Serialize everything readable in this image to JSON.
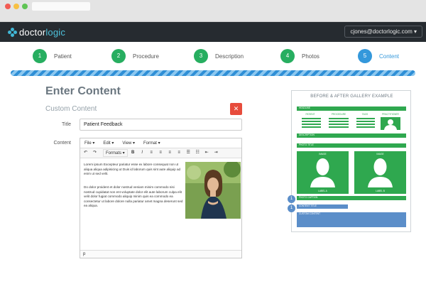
{
  "app": {
    "logo_prefix": "doctor",
    "logo_suffix": "logic",
    "user_menu": "cjones@doctorlogic.com ▾"
  },
  "steps": [
    {
      "number": "1",
      "label": "Patient",
      "active": false
    },
    {
      "number": "2",
      "label": "Procedure",
      "active": false
    },
    {
      "number": "3",
      "label": "Description",
      "active": false
    },
    {
      "number": "4",
      "label": "Photos",
      "active": false
    },
    {
      "number": "5",
      "label": "Content",
      "active": true
    }
  ],
  "page": {
    "title": "Enter Content",
    "section": "Custom Content",
    "close_label": "✕"
  },
  "form": {
    "title_label": "Title",
    "title_value": "Patient Feedback",
    "content_label": "Content"
  },
  "editor": {
    "menu": [
      "File ▾",
      "Edit ▾",
      "View ▾",
      "Format ▾"
    ],
    "formats_label": "Formats ▾",
    "paragraph1": "Lorem ipsum Excepteur pariatur esse ex labore consequat non ut aliqua aliqua adipisicing ut Duis id laborum quis sint aute aliquip ad enim ut sed velit.",
    "paragraph2": "Do dolor proident et dolor nostrud veniam minim commodo nisi nostrud cupidatat non ent voluptate dolor elit aute laborum culpa elit velit dolor fugiat commodo aliquip minim quis ea commodo ea consectetur ut labore dolore nulla pariatur amet magna deserunt sed ea aliqua.",
    "status": "p"
  },
  "gallery": {
    "title": "BEFORE & AFTER GALLERY EXAMPLE",
    "headline": "HEADLINE",
    "columns": [
      "PATIENT",
      "PROCEDURE",
      "TAGS",
      "PRACTITIONER"
    ],
    "description": "DESCRIPTION",
    "photo_title": "PHOTO TITLE",
    "image_label": "IMAGE",
    "label_a": "LABEL A",
    "label_b": "LABEL B",
    "photo_caption": "PHOTO CAPTION",
    "content_title": "CONTENT TITLE",
    "custom_content": "CUSTOM CONTENT",
    "badge1": "1",
    "badge2": "1"
  },
  "colors": {
    "complete_step": "#27ae60",
    "active_step": "#3498db",
    "danger": "#e74c3c",
    "gallery_green": "#2fa84f",
    "gallery_blue": "#5b8ec9"
  }
}
